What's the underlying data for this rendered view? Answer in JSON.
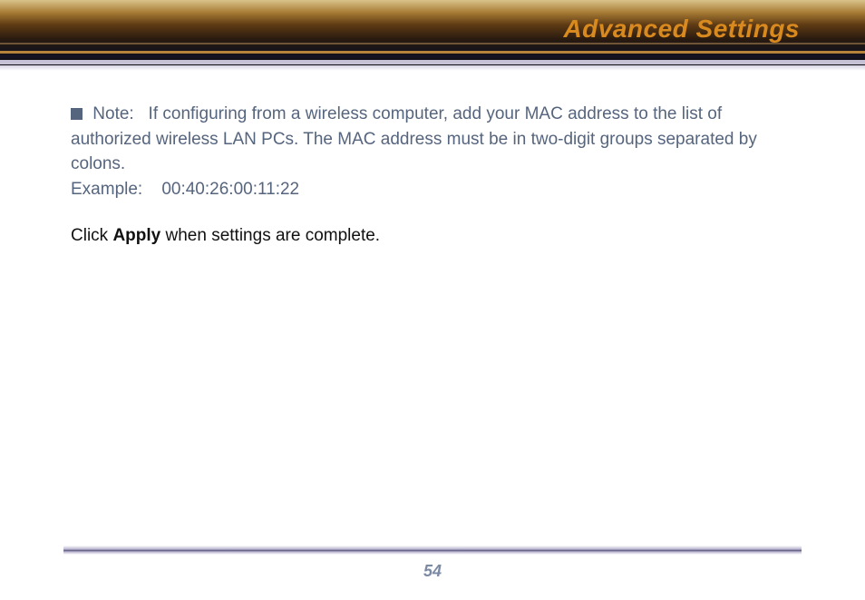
{
  "header": {
    "title": "Advanced Settings"
  },
  "note": {
    "label": "Note:",
    "body": "If configuring from a wireless computer, add your MAC address to the list of authorized wireless LAN PCs.  The MAC address must be in two-digit groups separated by colons.",
    "example_label": "Example:",
    "example_value": "00:40:26:00:11:22"
  },
  "instruction": {
    "prefix": "Click ",
    "bold_word": "Apply",
    "suffix": " when settings are complete."
  },
  "footer": {
    "page_number": "54"
  }
}
